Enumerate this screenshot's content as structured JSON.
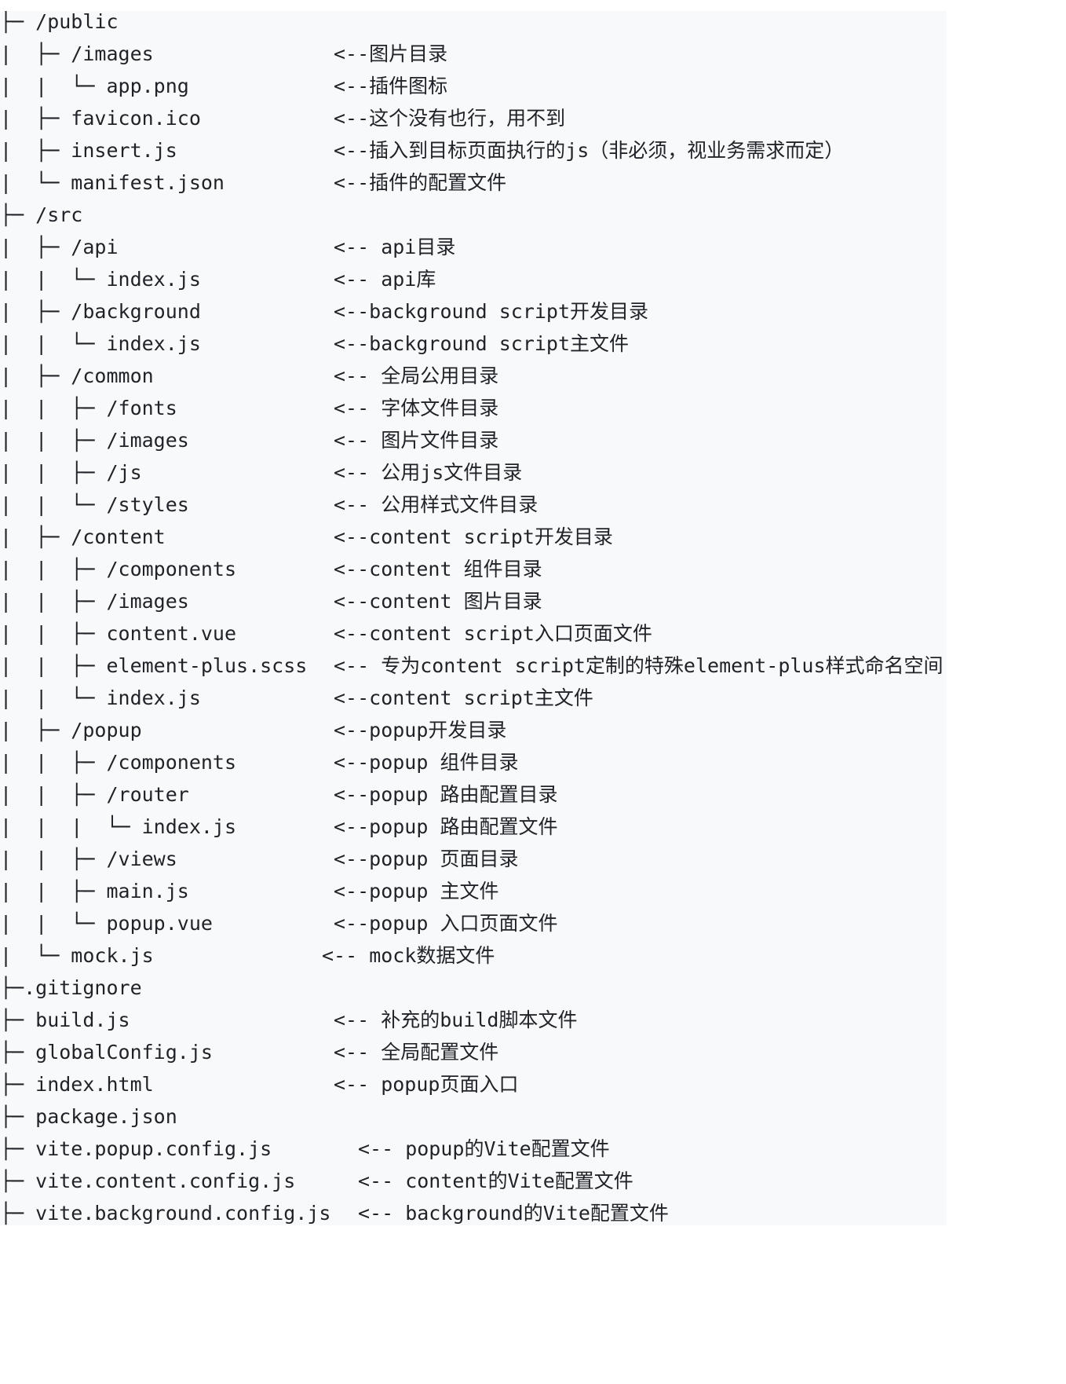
{
  "tree": {
    "lines": [
      {
        "path": "├─ /public",
        "comment": ""
      },
      {
        "path": "|  ├─ /images",
        "comment": "<--图片目录"
      },
      {
        "path": "|  |  └─ app.png",
        "comment": "<--插件图标"
      },
      {
        "path": "|  ├─ favicon.ico",
        "comment": "<--这个没有也行，用不到"
      },
      {
        "path": "|  ├─ insert.js",
        "comment": "<--插入到目标页面执行的js（非必须，视业务需求而定）"
      },
      {
        "path": "|  └─ manifest.json",
        "comment": "<--插件的配置文件"
      },
      {
        "path": "├─ /src",
        "comment": ""
      },
      {
        "path": "|  ├─ /api",
        "comment": "<-- api目录"
      },
      {
        "path": "|  |  └─ index.js",
        "comment": "<-- api库"
      },
      {
        "path": "|  ├─ /background",
        "comment": "<--background script开发目录"
      },
      {
        "path": "|  |  └─ index.js",
        "comment": "<--background script主文件"
      },
      {
        "path": "|  ├─ /common",
        "comment": "<-- 全局公用目录"
      },
      {
        "path": "|  |  ├─ /fonts",
        "comment": "<-- 字体文件目录"
      },
      {
        "path": "|  |  ├─ /images",
        "comment": "<-- 图片文件目录"
      },
      {
        "path": "|  |  ├─ /js",
        "comment": "<-- 公用js文件目录"
      },
      {
        "path": "|  |  └─ /styles",
        "comment": "<-- 公用样式文件目录"
      },
      {
        "path": "|  ├─ /content",
        "comment": "<--content script开发目录"
      },
      {
        "path": "|  |  ├─ /components",
        "comment": "<--content 组件目录"
      },
      {
        "path": "|  |  ├─ /images",
        "comment": "<--content 图片目录"
      },
      {
        "path": "|  |  ├─ content.vue",
        "comment": "<--content script入口页面文件"
      },
      {
        "path": "|  |  ├─ element-plus.scss",
        "comment": "<-- 专为content script定制的特殊element-plus样式命名空间"
      },
      {
        "path": "|  |  └─ index.js",
        "comment": "<--content script主文件"
      },
      {
        "path": "|  ├─ /popup",
        "comment": "<--popup开发目录"
      },
      {
        "path": "|  |  ├─ /components",
        "comment": "<--popup 组件目录"
      },
      {
        "path": "|  |  ├─ /router",
        "comment": "<--popup 路由配置目录"
      },
      {
        "path": "|  |  |  └─ index.js",
        "comment": "<--popup 路由配置文件"
      },
      {
        "path": "|  |  ├─ /views",
        "comment": "<--popup 页面目录"
      },
      {
        "path": "|  |  ├─ main.js",
        "comment": "<--popup 主文件"
      },
      {
        "path": "|  |  └─ popup.vue",
        "comment": "<--popup 入口页面文件"
      },
      {
        "path": "|  └─ mock.js",
        "comment": "<-- mock数据文件"
      },
      {
        "path": "├─.gitignore",
        "comment": ""
      },
      {
        "path": "├─ build.js",
        "comment": "<-- 补充的build脚本文件"
      },
      {
        "path": "├─ globalConfig.js",
        "comment": "<-- 全局配置文件"
      },
      {
        "path": "├─ index.html",
        "comment": "<-- popup页面入口"
      },
      {
        "path": "├─ package.json",
        "comment": ""
      },
      {
        "path": "├─ vite.popup.config.js",
        "comment": "<-- popup的Vite配置文件"
      },
      {
        "path": "├─ vite.content.config.js",
        "comment": "<-- content的Vite配置文件"
      },
      {
        "path": "├─ vite.background.config.js",
        "comment": "<-- background的Vite配置文件"
      }
    ]
  }
}
